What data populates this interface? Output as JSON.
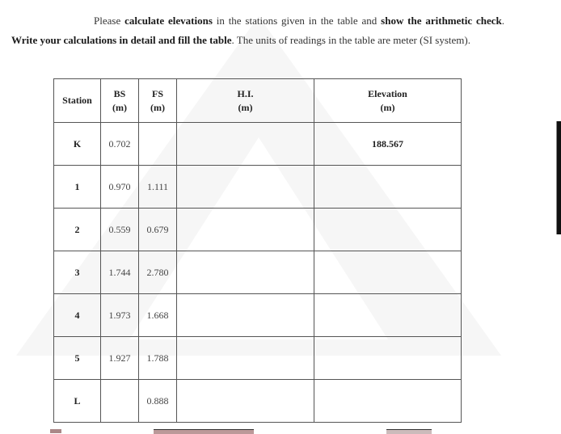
{
  "instructions": {
    "parts": [
      {
        "text": "Please ",
        "bold": false
      },
      {
        "text": "calculate elevations",
        "bold": true
      },
      {
        "text": " in the stations given in the table and ",
        "bold": false
      },
      {
        "text": "show the arithmetic check",
        "bold": true
      },
      {
        "text": ". ",
        "bold": false
      },
      {
        "text": "Write your calculations in detail and fill the table",
        "bold": true
      },
      {
        "text": ". The units of readings in the table are meter (SI system).",
        "bold": false
      }
    ]
  },
  "table": {
    "headers": {
      "station": "Station",
      "bs": "BS",
      "bs_unit": "(m)",
      "fs": "FS",
      "fs_unit": "(m)",
      "hi": "H.I.",
      "hi_unit": "(m)",
      "elevation": "Elevation",
      "elevation_unit": "(m)"
    },
    "rows": [
      {
        "station": "K",
        "bs": "0.702",
        "fs": "",
        "hi": "",
        "elevation": "188.567"
      },
      {
        "station": "1",
        "bs": "0.970",
        "fs": "1.111",
        "hi": "",
        "elevation": ""
      },
      {
        "station": "2",
        "bs": "0.559",
        "fs": "0.679",
        "hi": "",
        "elevation": ""
      },
      {
        "station": "3",
        "bs": "1.744",
        "fs": "2.780",
        "hi": "",
        "elevation": ""
      },
      {
        "station": "4",
        "bs": "1.973",
        "fs": "1.668",
        "hi": "",
        "elevation": ""
      },
      {
        "station": "5",
        "bs": "1.927",
        "fs": "1.788",
        "hi": "",
        "elevation": ""
      },
      {
        "station": "L",
        "bs": "",
        "fs": "0.888",
        "hi": "",
        "elevation": ""
      }
    ]
  }
}
